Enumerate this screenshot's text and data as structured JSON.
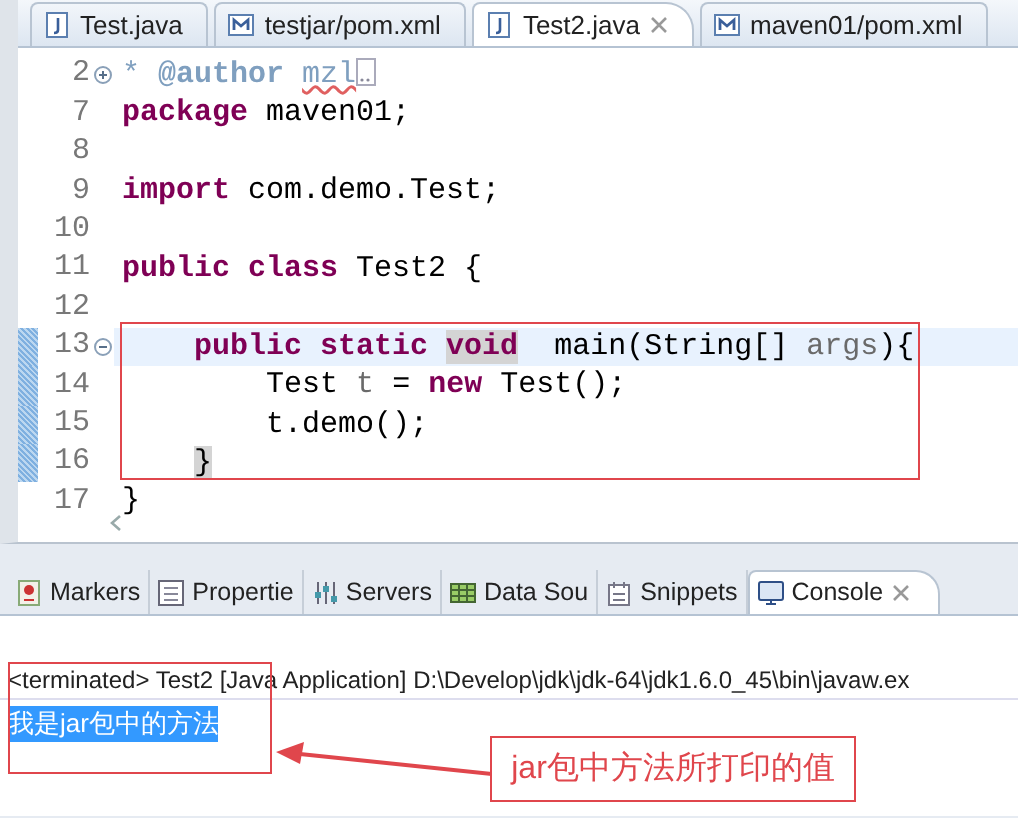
{
  "editor_tabs": [
    {
      "label": "Test.java",
      "kind": "java",
      "selected": false,
      "closable": false
    },
    {
      "label": "testjar/pom.xml",
      "kind": "maven",
      "selected": false,
      "closable": false
    },
    {
      "label": "Test2.java",
      "kind": "java",
      "selected": true,
      "closable": true
    },
    {
      "label": "maven01/pom.xml",
      "kind": "maven",
      "selected": false,
      "closable": false
    }
  ],
  "code_lines": [
    {
      "number": "2",
      "kind": "folded",
      "current": false,
      "changed": false,
      "segments": [
        {
          "text": "* ",
          "kind": "doc",
          "marked": false
        },
        {
          "text": "@author ",
          "kind": "doc-tag",
          "marked": false
        },
        {
          "text": "mzl",
          "kind": "doc-misspelt",
          "marked": false
        }
      ]
    },
    {
      "number": "7",
      "kind": "plain",
      "current": false,
      "changed": false,
      "segments": [
        {
          "text": "package",
          "kind": "keyword",
          "marked": false
        },
        {
          "text": " maven01;",
          "kind": "plain",
          "marked": false
        }
      ]
    },
    {
      "number": "8",
      "kind": "plain",
      "current": false,
      "changed": false
    },
    {
      "number": "9",
      "kind": "plain",
      "current": false,
      "changed": false,
      "segments": [
        {
          "text": "import",
          "kind": "keyword",
          "marked": false
        },
        {
          "text": " com.demo.Test;",
          "kind": "plain",
          "marked": false
        }
      ]
    },
    {
      "number": "10",
      "kind": "plain",
      "current": false,
      "changed": false
    },
    {
      "number": "11",
      "kind": "plain",
      "current": false,
      "changed": false,
      "segments": [
        {
          "text": "public class",
          "kind": "keyword",
          "marked": false
        },
        {
          "text": " Test2 {",
          "kind": "plain",
          "marked": false
        }
      ]
    },
    {
      "number": "12",
      "kind": "plain",
      "current": false,
      "changed": false
    },
    {
      "number": "13",
      "kind": "foldable",
      "current": true,
      "changed": true,
      "segments": [
        {
          "text": "    public static ",
          "kind": "keyword",
          "marked": false
        },
        {
          "text": "void",
          "kind": "keyword",
          "marked": true
        },
        {
          "text": "  main(String[] ",
          "kind": "plain",
          "marked": false
        },
        {
          "text": "args",
          "kind": "variable",
          "marked": false
        },
        {
          "text": "){",
          "kind": "plain",
          "marked": false
        }
      ]
    },
    {
      "number": "14",
      "kind": "plain",
      "current": false,
      "changed": true,
      "segments": [
        {
          "text": "        Test ",
          "kind": "plain",
          "marked": false
        },
        {
          "text": "t",
          "kind": "variable",
          "marked": false
        },
        {
          "text": " = ",
          "kind": "plain",
          "marked": false
        },
        {
          "text": "new",
          "kind": "keyword",
          "marked": false
        },
        {
          "text": " Test();",
          "kind": "plain",
          "marked": false
        }
      ]
    },
    {
      "number": "15",
      "kind": "plain",
      "current": false,
      "changed": true,
      "segments": [
        {
          "text": "        t.demo();",
          "kind": "plain",
          "marked": false
        }
      ]
    },
    {
      "number": "16",
      "kind": "plain",
      "current": false,
      "changed": true,
      "segments": [
        {
          "text": "    }",
          "kind": "plain",
          "marked": true
        }
      ]
    },
    {
      "number": "17",
      "kind": "plain",
      "current": false,
      "changed": false,
      "segments": [
        {
          "text": "}",
          "kind": "plain",
          "marked": false
        }
      ]
    }
  ],
  "panel_tabs": [
    {
      "label": "Markers",
      "selected": false,
      "closable": false
    },
    {
      "label": "Propertie",
      "selected": false,
      "closable": false
    },
    {
      "label": "Servers",
      "selected": false,
      "closable": false
    },
    {
      "label": "Data Sou",
      "selected": false,
      "closable": false
    },
    {
      "label": "Snippets",
      "selected": false,
      "closable": false
    },
    {
      "label": "Console",
      "selected": true,
      "closable": true
    }
  ],
  "console": {
    "header": "<terminated> Test2 [Java Application] D:\\Develop\\jdk\\jdk-64\\jdk1.6.0_45\\bin\\javaw.ex",
    "output": "我是jar包中的方法",
    "output_selected": true
  },
  "callout": {
    "text": "jar包中方法所打印的值"
  }
}
